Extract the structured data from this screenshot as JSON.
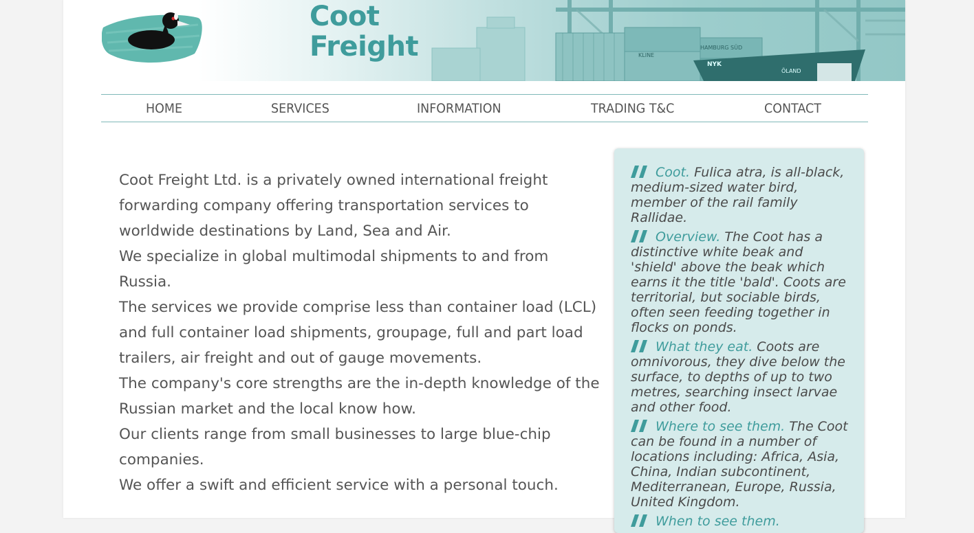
{
  "brand": {
    "name_line1": "Coot",
    "name_line2": "Freight",
    "accent_color": "#3f9c9c"
  },
  "banner": {
    "ship_label_1": "KLINE",
    "ship_label_2": "HAMBURG SÜD",
    "ship_label_3": "NYK",
    "ship_name": "ÖLAND"
  },
  "nav": {
    "items": [
      {
        "label": "HOME"
      },
      {
        "label": "SERVICES"
      },
      {
        "label": "INFORMATION"
      },
      {
        "label": "TRADING T&C"
      },
      {
        "label": "CONTACT"
      }
    ]
  },
  "main": {
    "paragraphs": [
      "Coot Freight Ltd. is a privately owned international freight forwarding company offering transportation services to worldwide destinations by Land, Sea and Air.",
      "We specialize in global multimodal shipments to and from Russia.",
      "The services we provide comprise less than container load (LCL) and full container load shipments, groupage, full and part load trailers, air freight and out of gauge movements.",
      "The company's core strengths are the in-depth knowledge of the Russian market and the local know how.",
      "Our clients range from small businesses to large blue-chip companies.",
      "We offer a swift and efficient service with a personal touch."
    ]
  },
  "sidebar": {
    "facts": [
      {
        "title": "Coot.",
        "text": "Fulica atra, is all-black, medium-sized water bird, member of the rail family Rallidae."
      },
      {
        "title": "Overview.",
        "text": "The Coot has a distinctive white beak and 'shield' above the beak which earns it the title 'bald'. Coots are territorial, but  sociable birds, often seen feeding together in flocks on ponds."
      },
      {
        "title": "What they eat.",
        "text": "Coots are omnivorous, they dive below the surface, to depths of up to two metres, searching insect larvae and other food."
      },
      {
        "title": "Where to see them.",
        "text": "The Coot can be found in a number of locations including: Africa, Asia, China,  Indian subcontinent, Mediterranean, Europe, Russia, United Kingdom."
      },
      {
        "title": "When to see them.",
        "text": ""
      }
    ]
  }
}
